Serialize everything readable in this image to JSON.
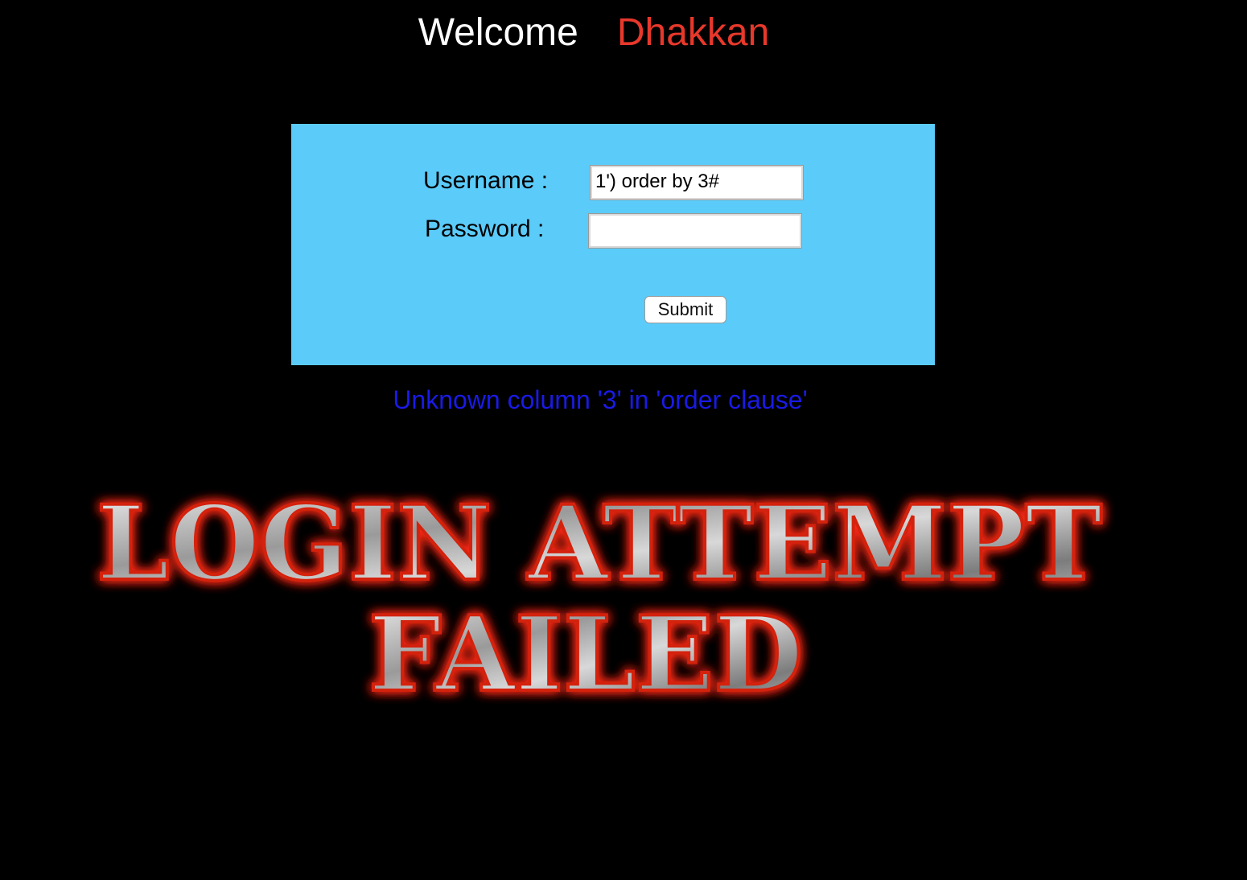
{
  "header": {
    "welcome_text": "Welcome",
    "name_text": "Dhakkan"
  },
  "form": {
    "username_label": "Username :",
    "password_label": "Password :",
    "username_value": "1') order by 3#",
    "password_value": "",
    "submit_label": "Submit"
  },
  "result": {
    "error_message": "Unknown column '3' in 'order clause'",
    "banner_line1": "LOGIN ATTEMPT",
    "banner_line2": "FAILED"
  },
  "colors": {
    "background": "#000000",
    "form_background": "#5bcbf9",
    "name_color": "#e8382b",
    "error_color": "#1a1ae6",
    "banner_glow": "#ff2a1a"
  }
}
